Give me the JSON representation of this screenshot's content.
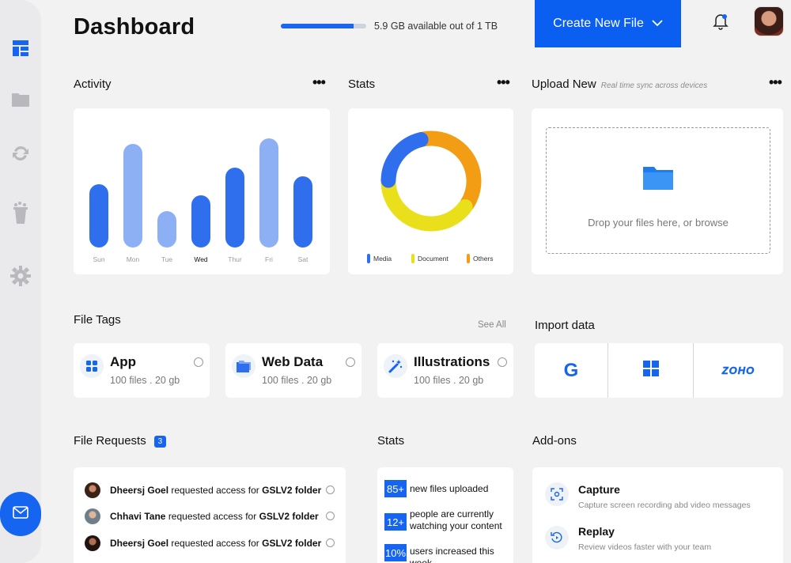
{
  "header": {
    "title": "Dashboard",
    "storage": {
      "text": "5.9 GB available out of 1 TB",
      "used_fraction": 0.85
    },
    "create_button": "Create New File"
  },
  "sidebar": {
    "items": [
      {
        "icon": "dashboard-grid-icon"
      },
      {
        "icon": "folder-icon"
      },
      {
        "icon": "sync-icon"
      },
      {
        "icon": "trash-icon"
      },
      {
        "icon": "gear-icon"
      }
    ],
    "mail_icon": "mail-icon"
  },
  "activity": {
    "title": "Activity",
    "days": [
      {
        "label": "Sun",
        "value": 0.5,
        "color": "#2f6fee"
      },
      {
        "label": "Mon",
        "value": 0.82,
        "color": "#8db0f4"
      },
      {
        "label": "Tue",
        "value": 0.29,
        "color": "#8db0f4"
      },
      {
        "label": "Wed",
        "value": 0.41,
        "color": "#2f6fee"
      },
      {
        "label": "Thur",
        "value": 0.63,
        "color": "#2f6fee"
      },
      {
        "label": "Fri",
        "value": 0.86,
        "color": "#8db0f4"
      },
      {
        "label": "Sat",
        "value": 0.56,
        "color": "#2f6fee"
      }
    ]
  },
  "stats_donut": {
    "title": "Stats",
    "segments": [
      {
        "label": "Media",
        "value": 22,
        "color": "#2f6fee"
      },
      {
        "label": "Document",
        "value": 40,
        "color": "#e9df1b"
      },
      {
        "label": "Others",
        "value": 38,
        "color": "#f29d14"
      }
    ]
  },
  "upload": {
    "title": "Upload New",
    "subtitle": "Real time sync across devices",
    "drop_text": "Drop your files here, or browse"
  },
  "file_tags": {
    "title": "File Tags",
    "see_all": "See All",
    "items": [
      {
        "name": "App",
        "meta": "100 files . 20 gb",
        "icon": "apps-grid-icon"
      },
      {
        "name": "Web Data",
        "meta": "100 files . 20 gb",
        "icon": "folders-icon"
      },
      {
        "name": "Illustrations",
        "meta": "100 files . 20 gb",
        "icon": "magic-wand-icon"
      }
    ]
  },
  "import": {
    "title": "Import data",
    "sources": [
      {
        "icon": "google-icon",
        "text": "G"
      },
      {
        "icon": "windows-icon"
      },
      {
        "icon": "zoho-logo",
        "text": "ZOHO"
      }
    ]
  },
  "file_requests": {
    "title": "File Requests",
    "count": "3",
    "items": [
      {
        "name": "Dheersj Goel",
        "action": "requested access for",
        "target": "GSLV2 folder"
      },
      {
        "name": "Chhavi Tane",
        "action": "requested access for",
        "target": "GSLV2 folder"
      },
      {
        "name": "Dheersj Goel",
        "action": "requested access for",
        "target": "GSLV2 folder"
      }
    ]
  },
  "stats_list": {
    "title": "Stats",
    "items": [
      {
        "num": "85+",
        "text": "new files uploaded"
      },
      {
        "num": "12+",
        "text": "people are currently watching your content"
      },
      {
        "num": "10%",
        "text": "users increased this week"
      }
    ]
  },
  "addons": {
    "title": "Add-ons",
    "items": [
      {
        "title": "Capture",
        "desc": "Capture screen recording abd video messages",
        "icon": "capture-icon"
      },
      {
        "title": "Replay",
        "desc": "Review videos faster with your team",
        "icon": "replay-icon"
      }
    ]
  }
}
